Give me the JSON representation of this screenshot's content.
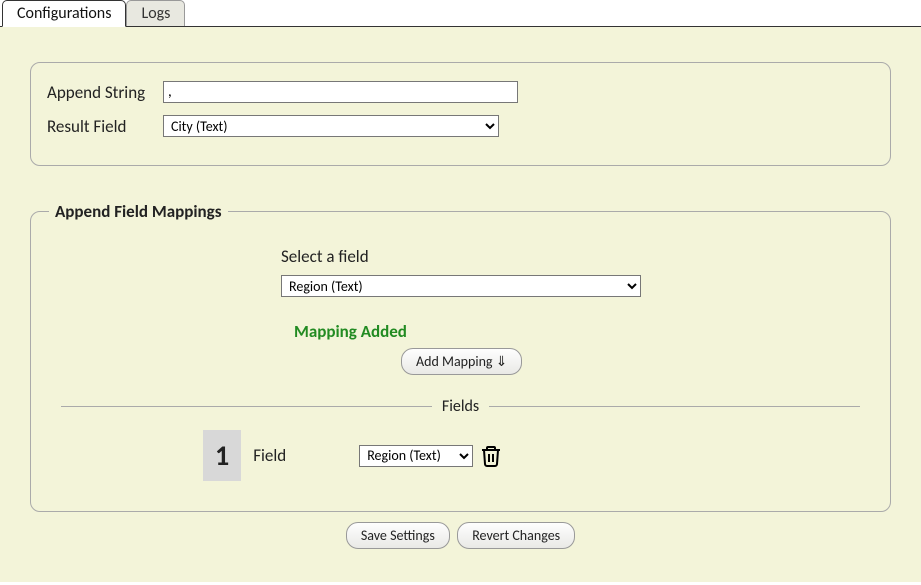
{
  "tabs": {
    "configurations": "Configurations",
    "logs": "Logs"
  },
  "form": {
    "append_string_label": "Append String",
    "append_string_value": ",",
    "result_field_label": "Result Field",
    "result_field_value": "City (Text)"
  },
  "mappings": {
    "legend": "Append Field Mappings",
    "select_field_label": "Select a field",
    "select_field_value": "Region (Text)",
    "status_message": "Mapping Added",
    "add_button_label": "Add Mapping ⇓",
    "fields_heading": "Fields"
  },
  "field_rows": [
    {
      "index": "1",
      "label": "Field",
      "value": "Region (Text)"
    }
  ],
  "footer": {
    "save_label": "Save Settings",
    "revert_label": "Revert Changes"
  }
}
